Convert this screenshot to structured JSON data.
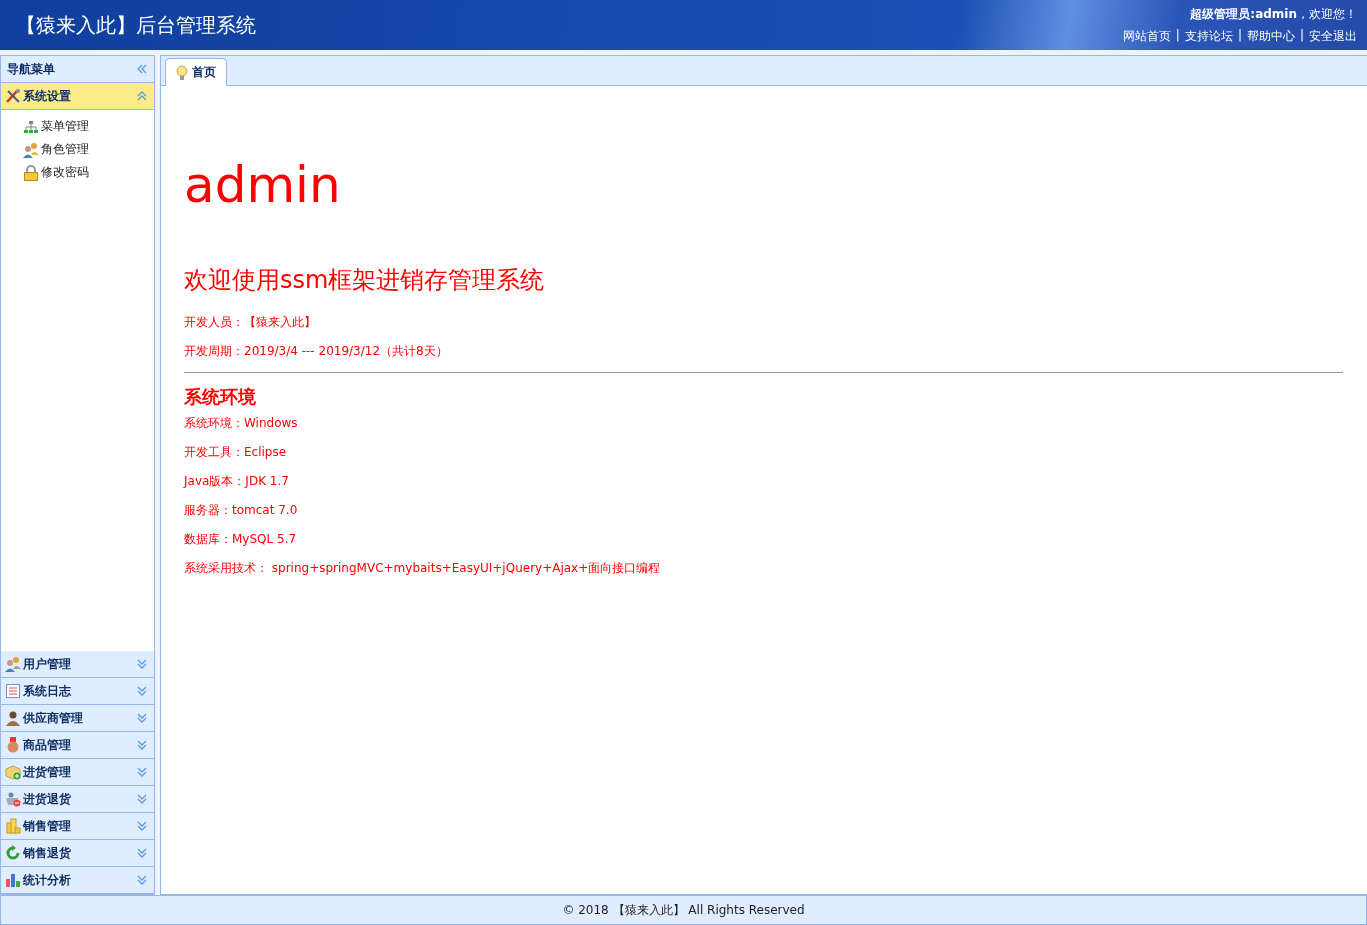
{
  "header": {
    "title": "【猿来入此】后台管理系统",
    "greeting": "**超级管理员:admin**，欢迎您！",
    "links": [
      "网站首页",
      "支持论坛",
      "帮助中心",
      "安全退出"
    ],
    "separator": "|"
  },
  "sidebar": {
    "title": "导航菜单",
    "groups": [
      {
        "label": "系统设置",
        "expanded": true,
        "children": [
          {
            "label": "菜单管理"
          },
          {
            "label": "角色管理"
          },
          {
            "label": "修改密码"
          }
        ]
      },
      {
        "label": "用户管理",
        "expanded": false
      },
      {
        "label": "系统日志",
        "expanded": false
      },
      {
        "label": "供应商管理",
        "expanded": false
      },
      {
        "label": "商品管理",
        "expanded": false
      },
      {
        "label": "进货管理",
        "expanded": false
      },
      {
        "label": "进货退货",
        "expanded": false
      },
      {
        "label": "销售管理",
        "expanded": false
      },
      {
        "label": "销售退货",
        "expanded": false
      },
      {
        "label": "统计分析",
        "expanded": false
      }
    ]
  },
  "tabs": [
    {
      "label": "首页",
      "selected": true
    }
  ],
  "content": {
    "heading": "admin",
    "subtitle": "欢迎使用ssm框架进销存管理系统",
    "info": [
      "开发人员：【猿来入此】",
      "开发周期：2019/3/4 --- 2019/3/12（共计8天）"
    ],
    "section_title": "系统环境",
    "environment": [
      "系统环境：Windows",
      "开发工具：Eclipse",
      "Java版本：JDK 1.7",
      "服务器：tomcat 7.0",
      "数据库：MySQL 5.7",
      "系统采用技术： spring+springMVC+mybaits+EasyUI+jQuery+Ajax+面向接口编程"
    ]
  },
  "footer": "© 2018 【猿来入此】 All Rights Reserved"
}
